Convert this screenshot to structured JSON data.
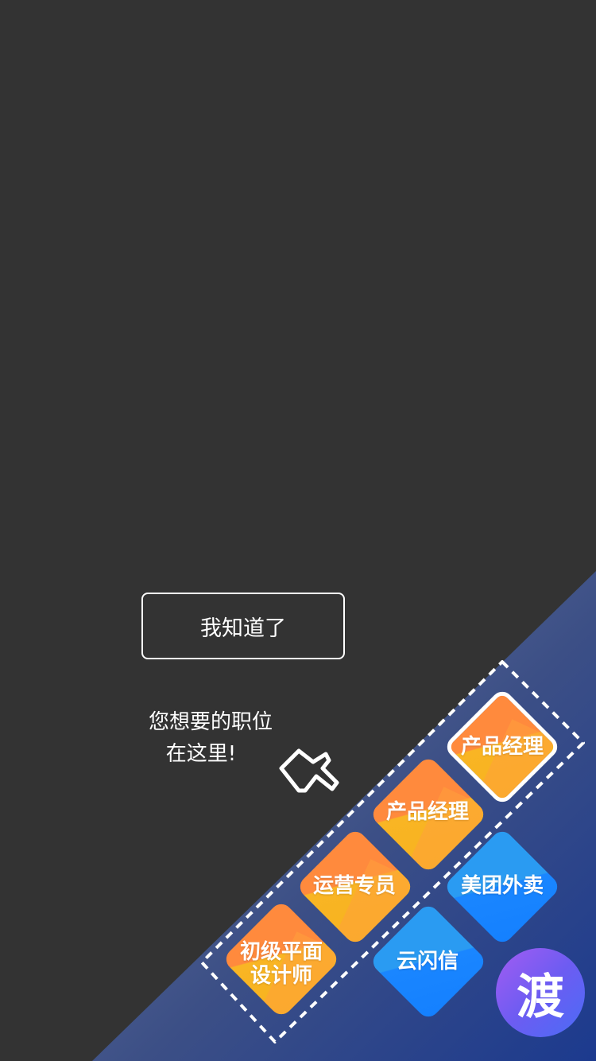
{
  "guide": {
    "got_it_label": "我知道了",
    "hint_line1": "您想要的职位",
    "hint_line2": "在这里!"
  },
  "tiles": [
    {
      "label": "产品经理",
      "style": "orange",
      "selected": true
    },
    {
      "label": "产品经理",
      "style": "orange",
      "selected": false
    },
    {
      "label": "运营专员",
      "style": "orange",
      "selected": false
    },
    {
      "label_line1": "初级平面",
      "label_line2": "设计师",
      "style": "orange",
      "selected": false
    },
    {
      "label": "美团外卖",
      "style": "blue",
      "selected": false
    },
    {
      "label": "云闪信",
      "style": "blue",
      "selected": false
    }
  ],
  "logo": {
    "text": "渡"
  },
  "icons": {
    "pointer": "hand-pointer-icon"
  },
  "colors": {
    "overlay": "#333333",
    "panel_start": "#6a7a96",
    "panel_end": "#1f3a8a",
    "tile_orange": "#f9b524",
    "tile_blue": "#1a86ff",
    "logo": "#7a5cf2"
  }
}
